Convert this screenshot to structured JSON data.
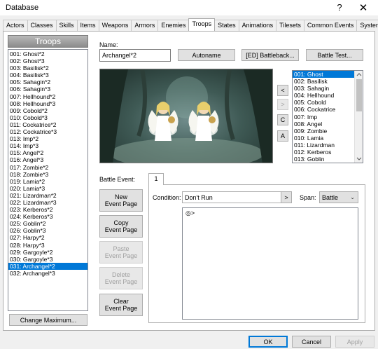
{
  "window": {
    "title": "Database",
    "help": "?",
    "close": "✕"
  },
  "tabs": [
    "Actors",
    "Classes",
    "Skills",
    "Items",
    "Weapons",
    "Armors",
    "Enemies",
    "Troops",
    "States",
    "Animations",
    "Tilesets",
    "Common Events",
    "System"
  ],
  "troops": {
    "header": "Troops",
    "items": [
      "001: Ghost*2",
      "002: Ghost*3",
      "003: Basilisk*2",
      "004: Basilisk*3",
      "005: Sahagin*2",
      "006: Sahagin*3",
      "007: Hellhound*2",
      "008: Hellhound*3",
      "009: Cobold*2",
      "010: Cobold*3",
      "011: Cockatrice*2",
      "012: Cockatrice*3",
      "013: Imp*2",
      "014: Imp*3",
      "015: Angel*2",
      "016: Angel*3",
      "017: Zombie*2",
      "018: Zombie*3",
      "019: Lamia*2",
      "020: Lamia*3",
      "021: Lizardman*2",
      "022: Lizardman*3",
      "023: Kerberos*2",
      "024: Kerberos*3",
      "025: Goblin*2",
      "026: Goblin*3",
      "027: Harpy*2",
      "028: Harpy*3",
      "029: Gargoyle*2",
      "030: Gargoyle*3",
      "031: Archangel*2",
      "032: Archangel*3"
    ],
    "selected_index": 30,
    "change_max_label": "Change Maximum..."
  },
  "editor": {
    "name_label": "Name:",
    "name_value": "Archangel*2",
    "autoname_label": "Autoname",
    "battleback_label": "[ED] Battleback...",
    "battle_test_label": "Battle Test..."
  },
  "enemies": {
    "items": [
      "001: Ghost",
      "002: Basilisk",
      "003: Sahagin",
      "004: Hellhound",
      "005: Cobold",
      "006: Cockatrice",
      "007: Imp",
      "008: Angel",
      "009: Zombie",
      "010: Lamia",
      "011: Lizardman",
      "012: Kerberos",
      "013: Goblin"
    ],
    "selected_index": 0
  },
  "side_buttons": {
    "add": "<",
    "remove": ">",
    "clear": "C",
    "align": "A"
  },
  "battle_event": {
    "label": "Battle Event:",
    "page_tab": "1",
    "new_page": [
      "New",
      "Event Page"
    ],
    "copy_page": [
      "Copy",
      "Event Page"
    ],
    "paste_page": [
      "Paste",
      "Event Page"
    ],
    "delete_page": [
      "Delete",
      "Event Page"
    ],
    "clear_page": [
      "Clear",
      "Event Page"
    ],
    "condition_label": "Condition:",
    "condition_value": "Don't Run",
    "condition_button": ">",
    "span_label": "Span:",
    "span_value": "Battle",
    "command_line": "◎>"
  },
  "footer": {
    "ok": "OK",
    "cancel": "Cancel",
    "apply": "Apply"
  },
  "colors": {
    "selection": "#0078d7",
    "primary_border": "#0078d7"
  }
}
